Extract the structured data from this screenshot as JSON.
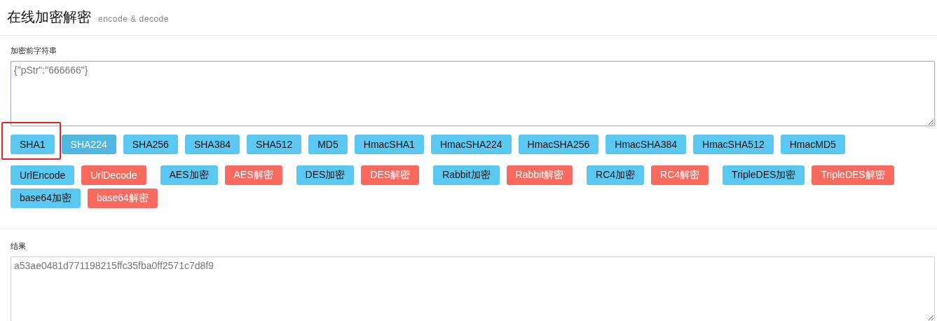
{
  "header": {
    "title": "在线加密解密",
    "subtitle": "encode & decode"
  },
  "input": {
    "label": "加密前字符串",
    "value": "{\"pStr\":\"666666\"}",
    "focused": true
  },
  "hash_buttons": [
    {
      "label": "SHA1",
      "selected": false,
      "highlighted": true
    },
    {
      "label": "SHA224",
      "selected": true,
      "highlighted": false
    },
    {
      "label": "SHA256",
      "selected": false,
      "highlighted": false
    },
    {
      "label": "SHA384",
      "selected": false,
      "highlighted": false
    },
    {
      "label": "SHA512",
      "selected": false,
      "highlighted": false
    },
    {
      "label": "MD5",
      "selected": false,
      "highlighted": false
    },
    {
      "label": "HmacSHA1",
      "selected": false,
      "highlighted": false
    },
    {
      "label": "HmacSHA224",
      "selected": false,
      "highlighted": false
    },
    {
      "label": "HmacSHA256",
      "selected": false,
      "highlighted": false
    },
    {
      "label": "HmacSHA384",
      "selected": false,
      "highlighted": false
    },
    {
      "label": "HmacSHA512",
      "selected": false,
      "highlighted": false
    },
    {
      "label": "HmacMD5",
      "selected": false,
      "highlighted": false
    }
  ],
  "cipher_groups": [
    {
      "buttons": [
        {
          "label": "UrlEncode",
          "kind": "encode"
        },
        {
          "label": "UrlDecode",
          "kind": "decode"
        }
      ]
    },
    {
      "buttons": [
        {
          "label": "AES加密",
          "kind": "encode"
        },
        {
          "label": "AES解密",
          "kind": "decode"
        }
      ]
    },
    {
      "buttons": [
        {
          "label": "DES加密",
          "kind": "encode"
        },
        {
          "label": "DES解密",
          "kind": "decode"
        }
      ]
    },
    {
      "buttons": [
        {
          "label": "Rabbit加密",
          "kind": "encode"
        },
        {
          "label": "Rabbit解密",
          "kind": "decode"
        }
      ]
    },
    {
      "buttons": [
        {
          "label": "RC4加密",
          "kind": "encode"
        },
        {
          "label": "RC4解密",
          "kind": "decode"
        }
      ]
    },
    {
      "buttons": [
        {
          "label": "TripleDES加密",
          "kind": "encode"
        },
        {
          "label": "TripleDES解密",
          "kind": "decode"
        }
      ]
    },
    {
      "buttons": [
        {
          "label": "base64加密",
          "kind": "encode"
        },
        {
          "label": "base64解密",
          "kind": "decode"
        }
      ]
    }
  ],
  "output": {
    "label": "结果",
    "value": "a53ae0481d771198215ffc35fba0ff2571c7d8f9",
    "focused": false
  }
}
